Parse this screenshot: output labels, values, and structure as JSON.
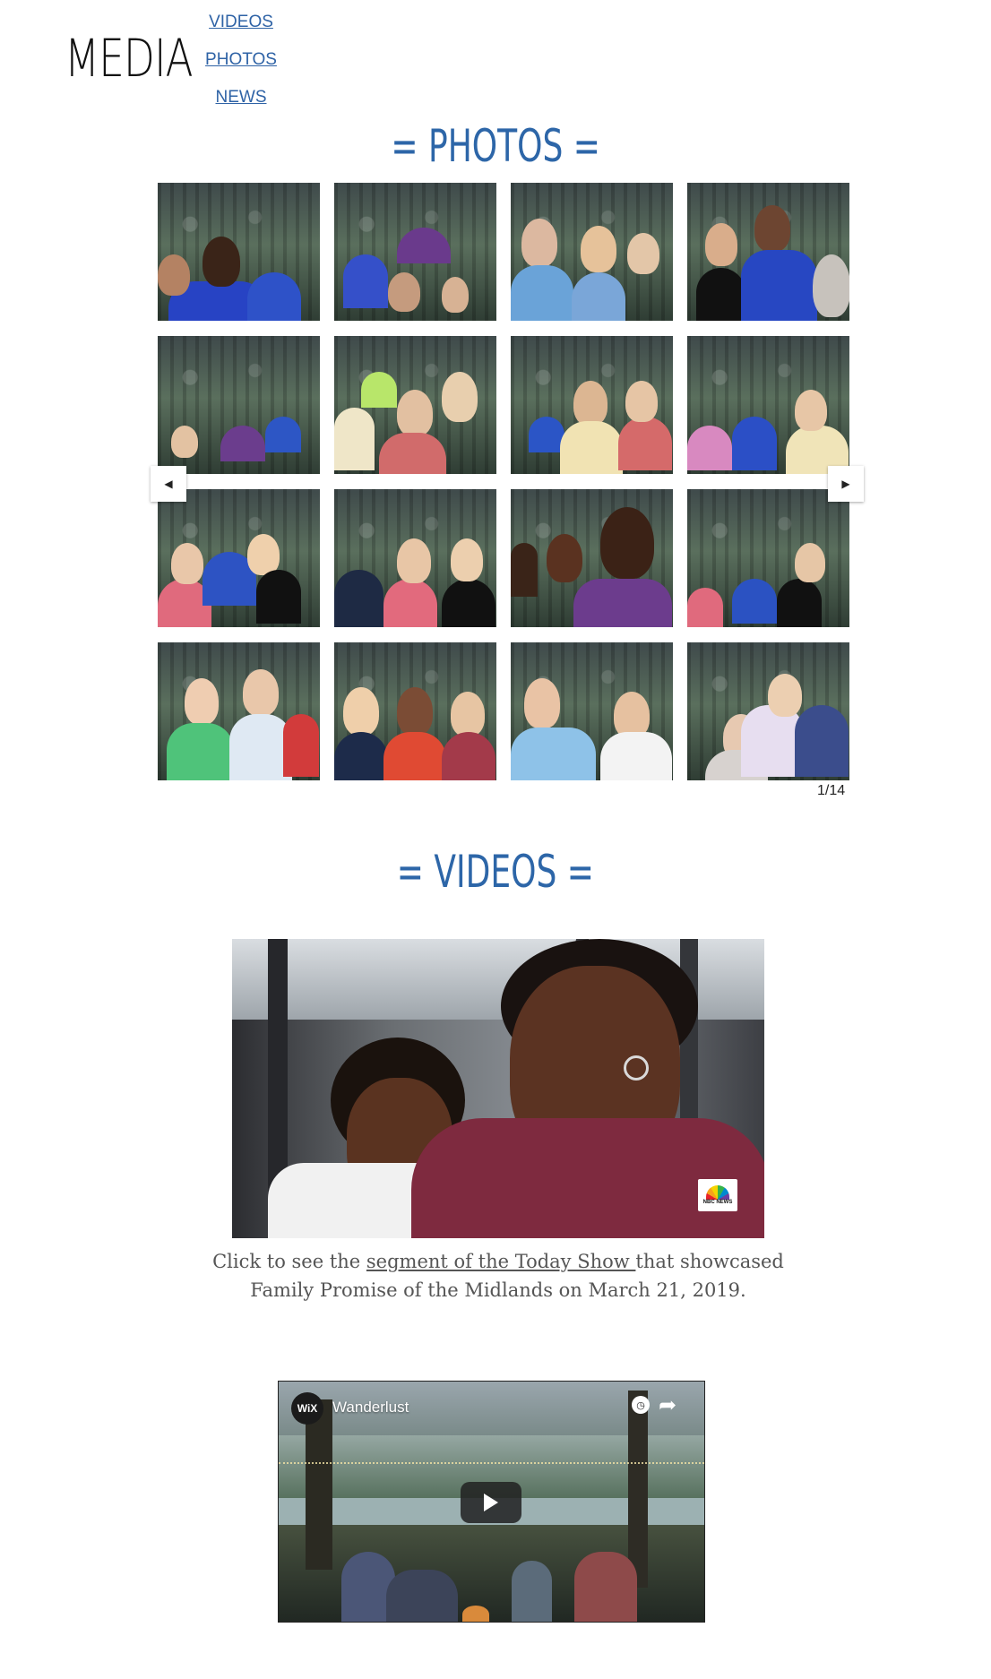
{
  "header": {
    "title": "MEDIA",
    "nav": [
      {
        "label": "VIDEOS"
      },
      {
        "label": "PHOTOS"
      },
      {
        "label": "NEWS"
      }
    ]
  },
  "photos_section": {
    "heading": "= PHOTOS =",
    "counter": "1/14",
    "prev_icon": "caret-left-icon",
    "next_icon": "caret-right-icon"
  },
  "videos_section": {
    "heading": "= VIDEOS =",
    "today_show": {
      "badge_icon": "nbc-peacock-icon",
      "badge_text": "NBC NEWS",
      "caption_before": "Click to see the ",
      "caption_link": "segment of the Today Show ",
      "caption_after": "that showcased Family Promise of the Midlands on March 21, 2019."
    },
    "wix_video": {
      "channel_logo": "WiX",
      "title": "Wanderlust",
      "play_icon": "play-icon",
      "watch_later_icon": "clock-icon",
      "share_icon": "share-icon"
    }
  },
  "colors": {
    "accent": "#2d66a8",
    "nav_link": "#2f63a6",
    "caption_text": "#555555"
  }
}
